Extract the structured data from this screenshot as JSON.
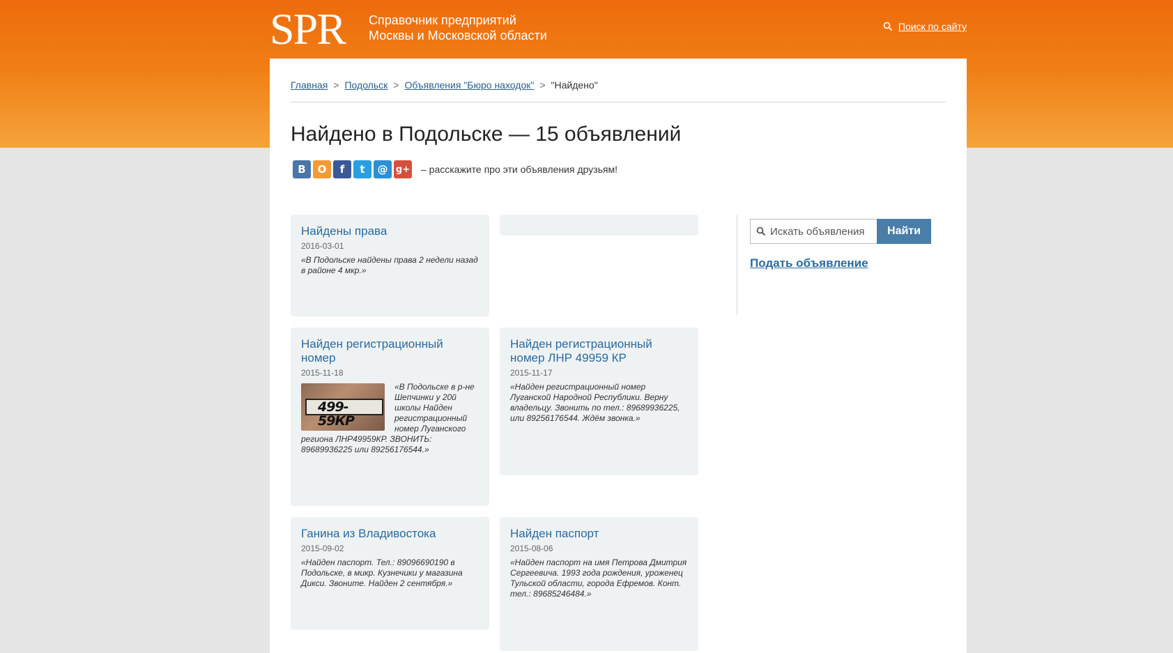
{
  "header": {
    "logo": "SPR",
    "tagline_line1": "Справочник предприятий",
    "tagline_line2": "Москвы и Московской области",
    "site_search_label": "Поиск по сайту"
  },
  "breadcrumb": {
    "home": "Главная",
    "city": "Подольск",
    "section": "Объявления \"Бюро находок\"",
    "current": "\"Найдено\"",
    "separator": ">"
  },
  "page_title": "Найдено в Подольске — 15 объявлений",
  "share": {
    "text": "– расскажите про эти объявления друзьям!",
    "icons": [
      {
        "name": "vk-icon",
        "glyph": "В",
        "color": "#4a76a8"
      },
      {
        "name": "odnoklassniki-icon",
        "glyph": "О",
        "color": "#f39a36"
      },
      {
        "name": "facebook-icon",
        "glyph": "f",
        "color": "#3b5998"
      },
      {
        "name": "twitter-icon",
        "glyph": "t",
        "color": "#2a9fe0"
      },
      {
        "name": "mailru-icon",
        "glyph": "@",
        "color": "#2d8fd5"
      },
      {
        "name": "googleplus-icon",
        "glyph": "g+",
        "color": "#d5503c"
      }
    ]
  },
  "cards": [
    {
      "title": "Найдены права",
      "date": "2016-03-01",
      "text": "«В Подольске найдены права 2 недели назад в районе 4 мкр.»"
    },
    {
      "title": "",
      "date": "",
      "text": ""
    },
    {
      "title": "Найден регистрационный номер",
      "date": "2015-11-18",
      "text": "«В Подольске в р-не Шепчинки у 20й школы Найден регистрационный номер Луганского региона ЛНР49959КР. ЗВОНИТЬ: 89689936225 или 89256176544.»",
      "plate_text": "499-59КР"
    },
    {
      "title": "Найден регистрационный номер ЛНР 49959 КР",
      "date": "2015-11-17",
      "text": "«Найден регистрационный номер Луганской Народной Республики. Верну владельцу. Звонить по тел.: 89689936225, или 89256176544. Ждём звонка.»"
    },
    {
      "title": "Ганина из Владивостока",
      "date": "2015-09-02",
      "text": "«Найден паспорт. Тел.: 89096690190 в Подольске, в микр. Кузнечики у магазина Дикси. Звоните. Найден 2 сентября.»"
    },
    {
      "title": "Найден паспорт",
      "date": "2015-08-06",
      "text": "«Найден паспорт на имя Петрова Дмитрия Сергеевича. 1993 года рождения, уроженец Тульской области, города Ефремов. Конт. тел.: 89685246484.»"
    }
  ],
  "sidebar": {
    "search_placeholder": "Искать объявления",
    "search_button": "Найти",
    "add_ad": "Подать объявление"
  }
}
